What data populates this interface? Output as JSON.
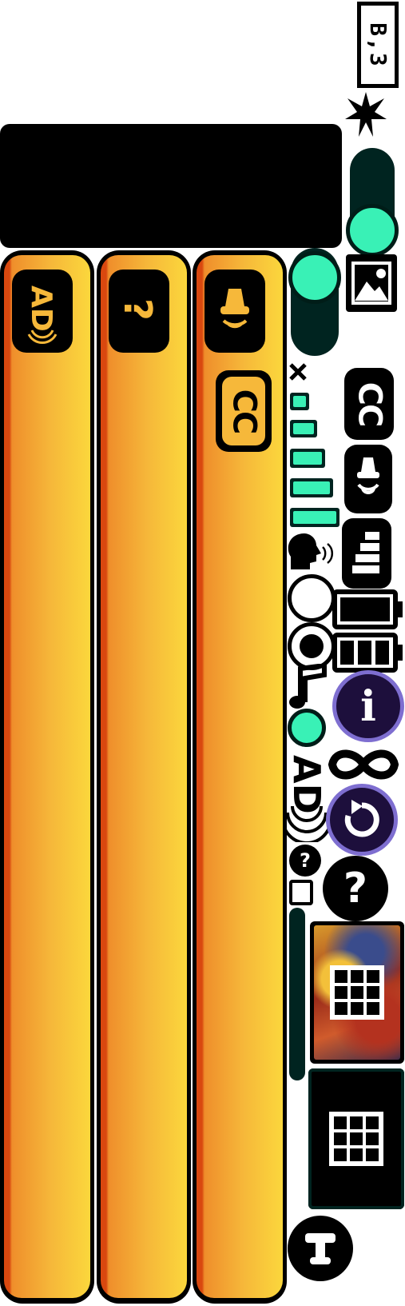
{
  "badge": {
    "text": "B,3"
  },
  "colors": {
    "accent_teal": "#39f1b6",
    "dark_teal": "#002420",
    "orange_light": "#fbd73c",
    "orange_mid": "#f6b83a",
    "orange_dark": "#d9480f",
    "purple_border": "#7e6ed0",
    "purple_fill": "#1d0f3c"
  },
  "columns": [
    {
      "name": "audio-description",
      "icon": "audio-description-icon",
      "icon_text": "AD"
    },
    {
      "name": "help",
      "icon": "question-mark-icon",
      "icon_text": "?"
    },
    {
      "name": "captions",
      "icon": "speaker-lamp-icon",
      "sub_label": "CC"
    }
  ],
  "right_panel": {
    "cc_label": "CC",
    "ad_label": "AD",
    "help_label": "?",
    "mini_help_label": "?",
    "info_label": "i",
    "volume_levels": [
      1,
      2,
      3,
      4,
      5
    ],
    "toggles": [
      {
        "name": "top-toggle",
        "state": "on"
      },
      {
        "name": "side-toggle",
        "state": "on"
      }
    ],
    "radio_selected": "second",
    "checkbox_checked": false
  },
  "icons": [
    "sparkle-icon",
    "image-icon",
    "close-icon",
    "speaker-lamp-icon",
    "list-icon",
    "speaking-head-icon",
    "battery-full-icon",
    "battery-bars-icon",
    "music-note-icon",
    "info-icon",
    "infinity-icon",
    "undo-icon",
    "grid-icon",
    "text-icon"
  ]
}
